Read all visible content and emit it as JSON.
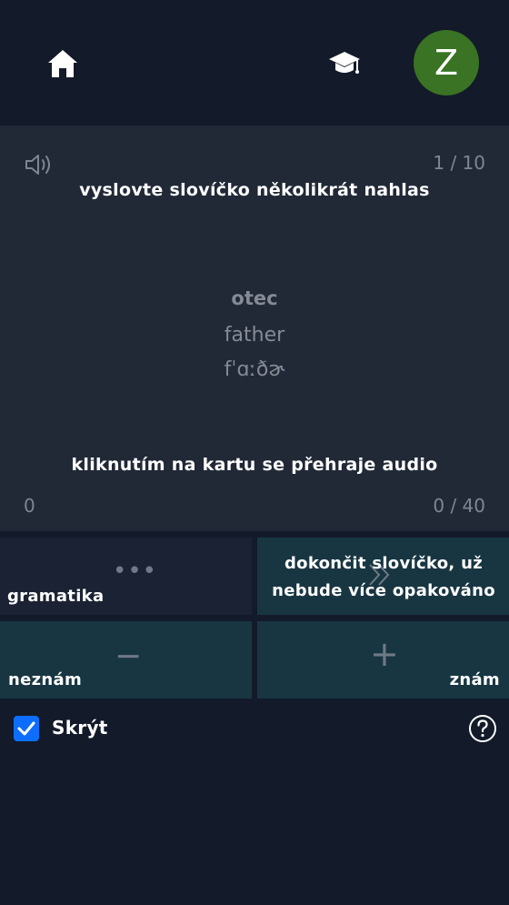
{
  "header": {
    "avatar_letter": "Z",
    "icons": {
      "home": "home-icon",
      "course": "graduation-cap-icon"
    }
  },
  "card": {
    "speaker_icon": "speaker-icon",
    "progress": "1 / 10",
    "hint_top": "vyslovte slovíčko několikrát nahlas",
    "word": "otec",
    "translation": "father",
    "phonetic": "fˈɑːðɚ",
    "hint_bottom": "kliknutím na kartu se přehraje audio",
    "count_left": "0",
    "count_right": "0 / 40"
  },
  "buttons": {
    "grammar": {
      "label": "gramatika",
      "icon": "more-dots-icon"
    },
    "finish": {
      "label": "dokončit slovíčko, už nebude více opakováno",
      "icon": "double-chevron-right-icon"
    },
    "unknown": {
      "label": "neznám",
      "icon": "minus-icon"
    },
    "know": {
      "label": "znám",
      "icon": "plus-icon"
    }
  },
  "footer": {
    "hide_label": "Skrýt",
    "hide_checked": true,
    "help_icon": "help-circle-icon"
  },
  "colors": {
    "background": "#131a29",
    "card": "#212937",
    "button_teal": "#183642",
    "button_dark": "#1a2233",
    "avatar": "#3a7323",
    "checkbox": "#0d6efd"
  }
}
